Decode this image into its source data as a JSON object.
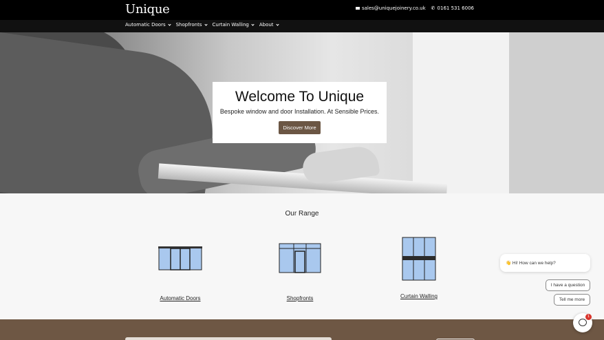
{
  "header": {
    "logo": "Unique",
    "email": "sales@uniquejoinery.co.uk",
    "phone": "0161 531 6006"
  },
  "nav": {
    "items": [
      {
        "label": "Automatic Doors"
      },
      {
        "label": "Shopfronts"
      },
      {
        "label": "Curtain Walling"
      },
      {
        "label": "About"
      }
    ]
  },
  "hero": {
    "title": "Welcome To Unique",
    "subtitle": "Bespoke window and door Installation. At Sensible Prices.",
    "button_label": "Discover More"
  },
  "range": {
    "title": "Our Range",
    "products": [
      {
        "label": "Automatic Doors",
        "icon": "automatic-door-icon"
      },
      {
        "label": "Shopfronts",
        "icon": "shopfront-icon"
      },
      {
        "label": "Curtain Walling",
        "icon": "curtain-wall-icon"
      }
    ]
  },
  "chat": {
    "greeting": "👋 Hi! How can we help?",
    "options": [
      "I have a question",
      "Tell me more"
    ],
    "badge_count": "1"
  },
  "colors": {
    "brand_brown": "#6b5644",
    "header_bg": "#000000",
    "glass_blue": "#a9c8ee"
  }
}
